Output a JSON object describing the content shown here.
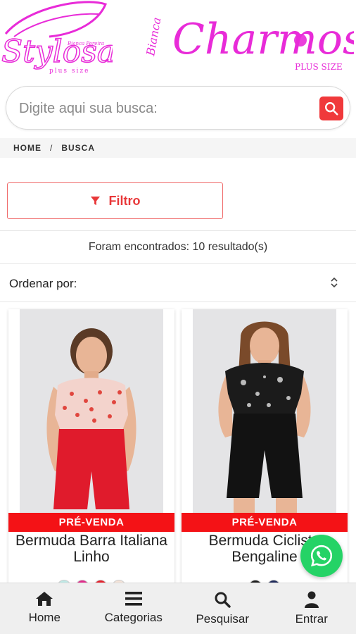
{
  "brand": {
    "logo_left": {
      "main": "Stylosa",
      "sub": "plus size",
      "tag": "Bianca Pereira"
    },
    "logo_right": {
      "main": "Charmosa",
      "sub": "PLUS SIZE",
      "prefix": "Bianca"
    }
  },
  "search": {
    "placeholder": "Digite aqui sua busca:",
    "button_icon": "search-icon"
  },
  "breadcrumb": {
    "items": [
      "HOME",
      "BUSCA"
    ],
    "separator": "/"
  },
  "filter": {
    "label": "Filtro",
    "icon": "filter-icon"
  },
  "results": {
    "text": "Foram encontrados: 10 resultado(s)"
  },
  "sort": {
    "label": "Ordenar por:",
    "icon": "chevron-updown-icon"
  },
  "products": [
    {
      "name": "Bermuda Barra Italiana Linho",
      "badge": "PRÉ-VENDA",
      "swatches": [
        "#bfe9e6",
        "#e02a8a",
        "#e3202b",
        "#f4e3d8"
      ]
    },
    {
      "name": "Bermuda Ciclista Bengaline",
      "badge": "PRÉ-VENDA",
      "swatches": [
        "#1d1d1d",
        "#1f2a5a"
      ]
    }
  ],
  "whatsapp": {
    "icon": "whatsapp-icon"
  },
  "bottom_nav": [
    {
      "label": "Home",
      "icon": "home-icon"
    },
    {
      "label": "Categorias",
      "icon": "menu-icon"
    },
    {
      "label": "Pesquisar",
      "icon": "search-icon"
    },
    {
      "label": "Entrar",
      "icon": "user-icon"
    }
  ],
  "colors": {
    "accent": "#f0393b",
    "brand_pink": "#e82bd8",
    "badge": "#f41216",
    "whatsapp": "#25d366"
  }
}
